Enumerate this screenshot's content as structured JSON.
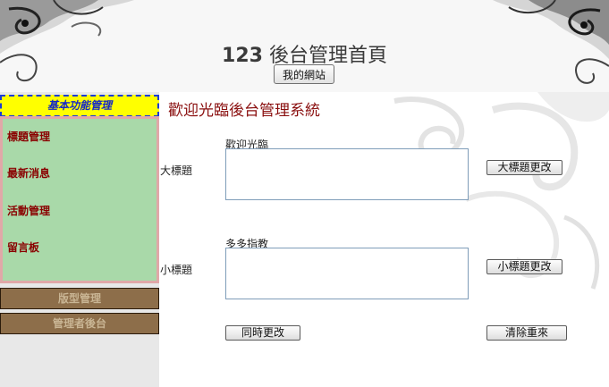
{
  "header": {
    "site_number": "123",
    "site_title": "後台管理首頁",
    "mysite_button": "我的網站"
  },
  "sidebar": {
    "heading": "基本功能管理",
    "items": [
      {
        "label": "標題管理"
      },
      {
        "label": "最新消息"
      },
      {
        "label": "活動管理"
      },
      {
        "label": "留言板"
      }
    ],
    "sections": [
      {
        "label": "版型管理"
      },
      {
        "label": "管理者後台"
      }
    ]
  },
  "main": {
    "welcome": "歡迎光臨後台管理系統",
    "big_title": {
      "label": "大標題",
      "current": "歡迎光臨",
      "value": "",
      "button": "大標題更改"
    },
    "sub_title": {
      "label": "小標題",
      "current": "多多指教",
      "value": "",
      "button": "小標題更改"
    },
    "update_both_button": "同時更改",
    "reset_button": "清除重來"
  },
  "colors": {
    "sidebar_heading_bg": "#ffff00",
    "sidebar_heading_border": "#1a3cd6",
    "sidebar_menu_bg": "#a9d9a9",
    "sidebar_menu_border": "#e0a8a8",
    "sidebar_item_text": "#8a0000",
    "section_button_bg": "#8d6e4a",
    "welcome_text": "#8a0f0f"
  }
}
